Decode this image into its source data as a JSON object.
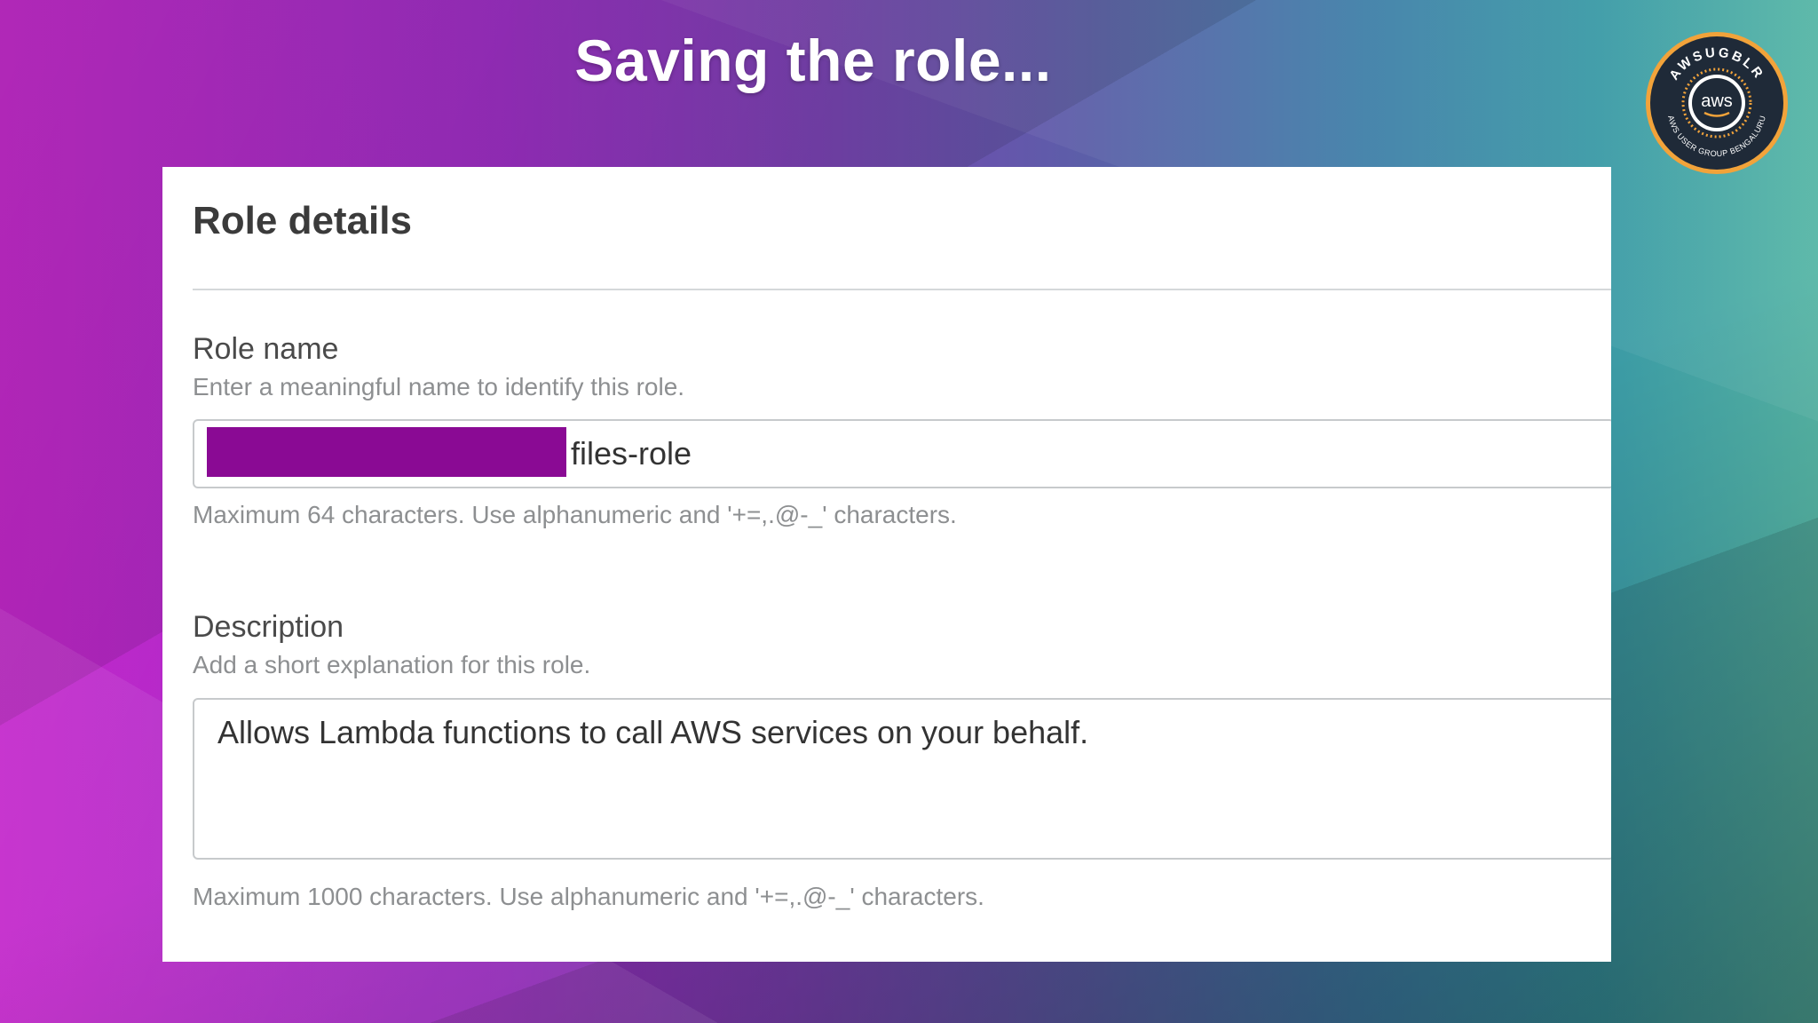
{
  "slide": {
    "title": "Saving the role..."
  },
  "badge": {
    "ring_text_top": "AWSUGBLR",
    "ring_text_bottom": "AWS USER GROUP BENGALURU",
    "center_text": "aws",
    "ring_color": "#f2a33a",
    "inner_color": "#1f2a38"
  },
  "role_details": {
    "heading": "Role details",
    "role_name": {
      "label": "Role name",
      "hint": "Enter a meaningful name to identify this role.",
      "value_suffix": "files-role",
      "redaction_color": "#8a0a94",
      "constraint": "Maximum 64 characters. Use alphanumeric and '+=,.@-_' characters."
    },
    "description": {
      "label": "Description",
      "hint": "Add a short explanation for this role.",
      "value": "Allows Lambda functions to call AWS services on your behalf.",
      "constraint": "Maximum 1000 characters. Use alphanumeric and '+=,.@-_' characters."
    }
  }
}
